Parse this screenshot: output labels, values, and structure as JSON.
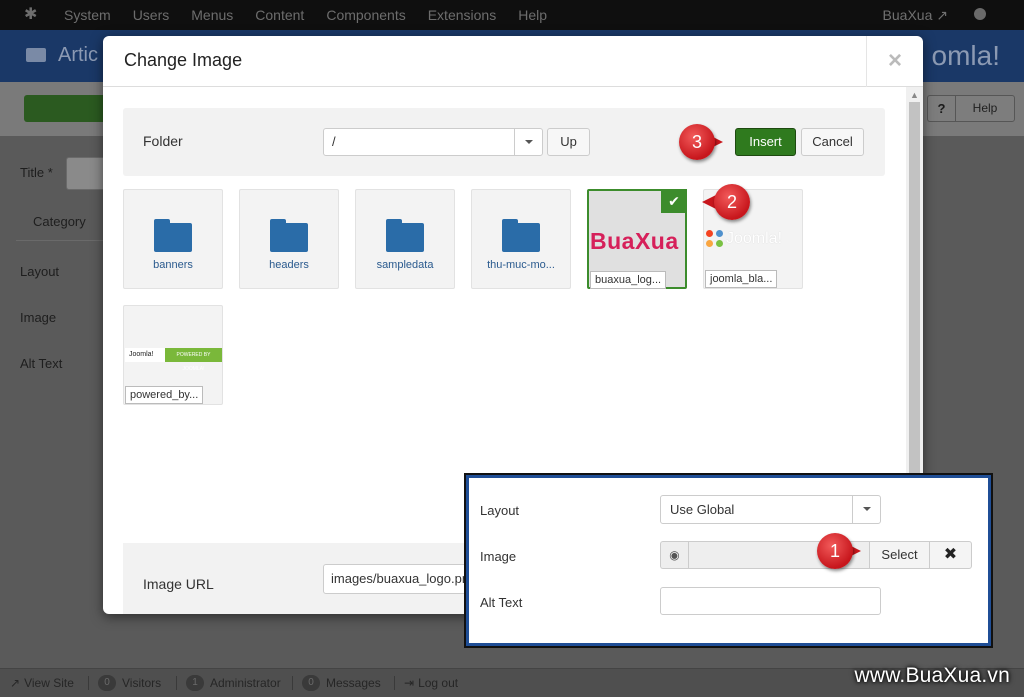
{
  "admin": {
    "menu": [
      "System",
      "Users",
      "Menus",
      "Content",
      "Components",
      "Extensions",
      "Help"
    ],
    "site_name": "BuaXua",
    "page_title": "Artic",
    "brand": "omla!",
    "help_label": "Help",
    "help_q": "?",
    "form_labels": {
      "title": "Title *",
      "category_tab": "Category",
      "layout": "Layout",
      "image": "Image",
      "alt_text": "Alt Text"
    },
    "status": {
      "view_site": "View Site",
      "visitors_count": "0",
      "visitors": "Visitors",
      "admin_count": "1",
      "administrator": "Administrator",
      "messages_count": "0",
      "messages": "Messages",
      "logout": "Log out"
    }
  },
  "modal": {
    "title": "Change Image",
    "close_glyph": "×",
    "folder_label": "Folder",
    "folder_value": "/",
    "up_label": "Up",
    "insert_label": "Insert",
    "cancel_label": "Cancel",
    "items": [
      {
        "kind": "folder",
        "name": "banners"
      },
      {
        "kind": "folder",
        "name": "headers"
      },
      {
        "kind": "folder",
        "name": "sampledata"
      },
      {
        "kind": "folder",
        "name": "thu-muc-mo..."
      },
      {
        "kind": "image",
        "name": "buaxua_log...",
        "art": "BuaXua",
        "selected": true
      },
      {
        "kind": "image",
        "name": "joomla_bla...",
        "art": "Joomla!"
      },
      {
        "kind": "image",
        "name": "powered_by...",
        "art_left": "Joomla!",
        "art_right": "POWERED BY JOOMLA!"
      }
    ],
    "url_label": "Image URL",
    "url_value": "images/buaxua_logo.png"
  },
  "inset": {
    "layout_label": "Layout",
    "layout_value": "Use Global",
    "image_label": "Image",
    "select_label": "Select",
    "clear_glyph": "✖",
    "alt_label": "Alt Text"
  },
  "markers": {
    "step1": "1",
    "step2": "2",
    "step3": "3"
  },
  "watermark": "www.BuaXua.vn",
  "colors": {
    "insert_green": "#2f7a1e",
    "selected_border": "#3c8c2c",
    "folder_blue": "#2a6ca8",
    "marker_red": "#c7161c",
    "inset_border": "#1f4e96"
  }
}
